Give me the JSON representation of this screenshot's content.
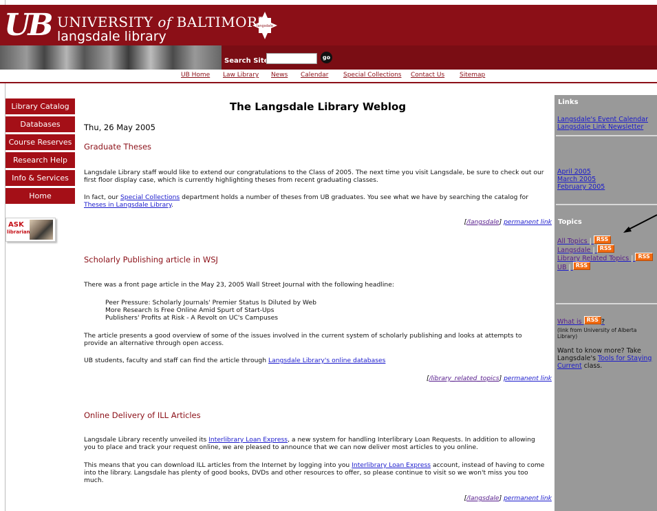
{
  "header": {
    "logo_ub": "UB",
    "logo_university_pre": "UNIVERSITY ",
    "logo_university_of": "of",
    "logo_university_post": " BALTIMORE",
    "logo_library": "langsdale library",
    "mark_text": "langsdale",
    "search_label": "Search Site",
    "search_value": "",
    "go_label": "go"
  },
  "topnav": [
    "UB Home",
    "Law Library",
    "News",
    "Calendar",
    "Special Collections",
    "Contact Us",
    "Sitemap"
  ],
  "leftnav": [
    "Library Catalog",
    "Databases",
    "Course Reserves",
    "Research Help",
    "Info & Services",
    "Home"
  ],
  "ask": {
    "word": "ASK",
    "sub": "librarian"
  },
  "main": {
    "title": "The Langsdale Library Weblog",
    "date": "Thu, 26 May 2005",
    "post1": {
      "title": "Graduate Theses",
      "p1": "Langsdale Library staff would like to extend our congratulations to the Class of 2005. The next time you visit Langsdale, be sure to check out our first floor display case, which is currently highlighting theses from recent graduating classes.",
      "p2_a": "In fact, our ",
      "p2_link": "Special Collections",
      "p2_b": " department holds a number of theses from UB graduates. You see what we have by searching the catalog for ",
      "p2_link2": "Theses in Langsdale Library",
      "p2_c": ".",
      "cat": "/langsdale",
      "perm": "permanent link"
    },
    "post2": {
      "title": "Scholarly Publishing article in WSJ",
      "p1": "There was a front page article in the May 23, 2005 Wall Street Journal with the following headline:",
      "q1": "Peer Pressure: Scholarly Journals' Premier Status Is Diluted by Web",
      "q2": "More Research Is Free Online Amid Spurt of Start-Ups",
      "q3": "Publishers' Profits at Risk - A Revolt on UC's Campuses",
      "p2": "The article presents a good overview of some of the issues involved in the current system of scholarly publishing and looks at attempts to provide an alternative through open access.",
      "p3_a": "UB students, faculty and staff can find the article through ",
      "p3_link": "Langsdale Library's online databases",
      "cat": "/library_related_topics",
      "perm": "permanent link"
    },
    "post3": {
      "title": "Online Delivery of ILL Articles",
      "p1_a": "Langsdale Library recently unveiled its ",
      "p1_link": "Interlibrary Loan Express",
      "p1_b": ", a new system for handling Interlibrary Loan Requests. In addition to allowing you to place and track your request online, we are pleased to announce that we can now deliver most articles to you online.",
      "p2_a": "This means that you can download ILL articles from the Internet by logging into you ",
      "p2_link": "Interlibrary Loan Express",
      "p2_b": " account, instead of having to come into the library. Langsdale has plenty of good books, DVDs and other resources to offer, so please continue to visit so we won't miss you too much.",
      "cat": "/langsdale",
      "perm": "permanent link"
    }
  },
  "sidebar": {
    "links_heading": "Links",
    "link1": "Langsdale's Event Calendar",
    "link2": "Langsdale Link Newsletter",
    "arch1": "April 2005",
    "arch2": "March 2005",
    "arch3": "February 2005",
    "topics_heading": "Topics",
    "t1": "All Topics",
    "t2": "Langsdale",
    "t3": "Library Related Topics",
    "t4": "UB",
    "rss": "RSS",
    "pipe": "|",
    "whatis": "What is",
    "whatis_q": "?",
    "whatis_note1": "(link from University of Alberta",
    "whatis_note2": "Library)",
    "more1": "Want to know more? Take",
    "more2_a": "Langsdale's ",
    "more2_link": "Tools for Staying",
    "more3_link": "Current",
    "more3_b": " class."
  }
}
